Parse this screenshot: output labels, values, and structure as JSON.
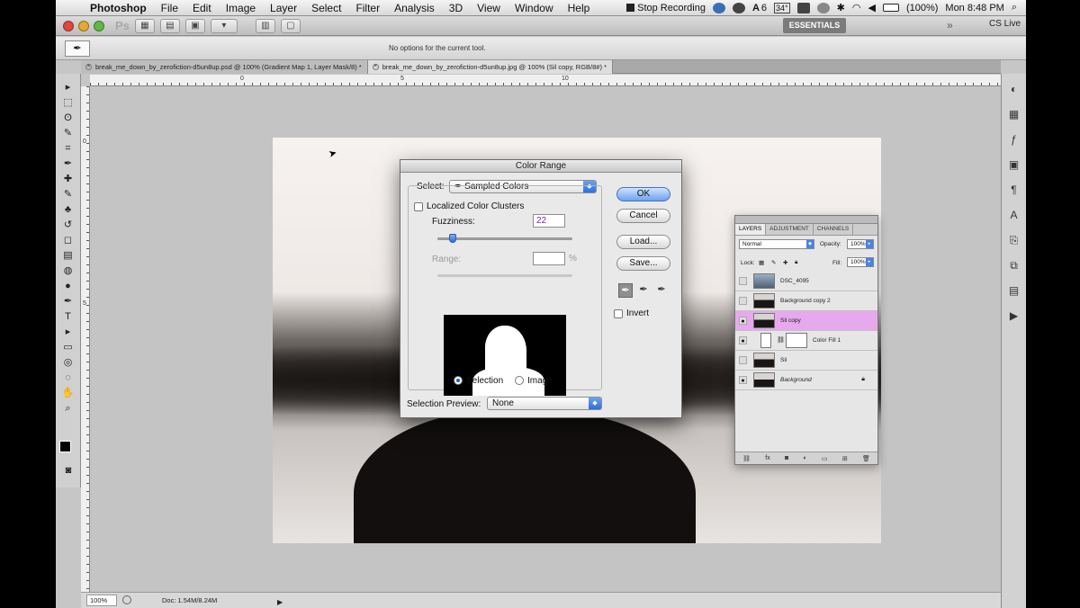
{
  "menubar": {
    "apple_symbol": "",
    "items": [
      "Photoshop",
      "File",
      "Edit",
      "Image",
      "Layer",
      "Select",
      "Filter",
      "Analysis",
      "3D",
      "View",
      "Window",
      "Help"
    ],
    "recording_label": "Stop Recording",
    "ai_label": "6",
    "temp_label": "34°",
    "battery": "(100%)",
    "clock": "Mon 8:48 PM"
  },
  "appbar": {
    "logo": "Ps",
    "essentials": "ESSENTIALS",
    "overflow": "»",
    "cslive": "CS Live"
  },
  "options_bar": {
    "message": "No options for the current tool."
  },
  "tabs": [
    {
      "label": "break_me_down_by_zerofiction-d5un8up.psd @ 100% (Gradient Map 1, Layer Mask/8) *",
      "active": false
    },
    {
      "label": "break_me_down_by_zerofiction-d5un8up.jpg @ 100% (Sil copy, RGB/8#) *",
      "active": true
    }
  ],
  "toolbox": {
    "tools": [
      "move-tool-icon",
      "marquee-tool-icon",
      "lasso-tool-icon",
      "quick-select-icon",
      "crop-tool-icon",
      "eyedropper-icon",
      "healing-brush-icon",
      "brush-icon",
      "clone-stamp-icon",
      "history-brush-icon",
      "eraser-icon",
      "gradient-icon",
      "blur-icon",
      "dodge-icon",
      "pen-icon",
      "type-icon",
      "path-select-icon",
      "shape-icon",
      "3d-rotate-icon",
      "3d-orbit-icon",
      "hand-icon",
      "zoom-icon"
    ],
    "glyphs": [
      "▸",
      "⬚",
      "ʘ",
      "✎",
      "⌗",
      "✒",
      "✚",
      "✎",
      "♣",
      "↺",
      "◻",
      "▤",
      "◍",
      "●",
      "✒",
      "T",
      "▸",
      "▭",
      "◎",
      "◌",
      "✋",
      "⌕"
    ]
  },
  "rulers": {
    "top": [
      "0",
      "5",
      "10"
    ],
    "left": [
      "0",
      "5"
    ]
  },
  "status": {
    "zoom": "100%",
    "doc_size": "Doc: 1.54M/8.24M",
    "arrow": "▶"
  },
  "dialog": {
    "title": "Color Range",
    "select_label": "Select:",
    "select_value": "Sampled Colors",
    "localized_label": "Localized Color Clusters",
    "localized_checked": false,
    "fuzziness_label": "Fuzziness:",
    "fuzziness_value": "22",
    "fuzziness_fraction": 0.11,
    "range_label": "Range:",
    "range_value": "",
    "range_unit": "%",
    "selection_label": "Selection",
    "image_label": "Image",
    "preview_mode": "selection",
    "selection_preview_label": "Selection Preview:",
    "selection_preview_value": "None",
    "buttons": {
      "ok": "OK",
      "cancel": "Cancel",
      "load": "Load...",
      "save": "Save..."
    },
    "invert_label": "Invert",
    "invert_checked": false,
    "eyedroppers": [
      "eyedropper-icon",
      "eyedropper-plus-icon",
      "eyedropper-minus-icon"
    ]
  },
  "layers_panel": {
    "tabs": [
      "LAYERS",
      "ADJUSTMENT",
      "CHANNELS"
    ],
    "blend_mode": "Normal",
    "opacity_label": "Opacity:",
    "opacity_value": "100%",
    "lock_label": "Lock:",
    "fill_label": "Fill:",
    "fill_value": "100%",
    "layers": [
      {
        "name": "DSC_4095",
        "visible": false,
        "selected": false,
        "type": "image",
        "italic": false
      },
      {
        "name": "Background copy 2",
        "visible": false,
        "selected": false,
        "type": "image",
        "italic": false
      },
      {
        "name": "Sil copy",
        "visible": true,
        "selected": true,
        "type": "image",
        "italic": false
      },
      {
        "name": "Color Fill 1",
        "visible": true,
        "selected": false,
        "type": "fill",
        "italic": false
      },
      {
        "name": "Sil",
        "visible": false,
        "selected": false,
        "type": "image",
        "italic": false
      },
      {
        "name": "Background",
        "visible": true,
        "selected": false,
        "type": "image",
        "italic": true,
        "locked": true
      }
    ],
    "footer_icons": [
      "link-layers-icon",
      "fx-icon",
      "add-mask-icon",
      "adjustment-layer-icon",
      "group-folder-icon",
      "new-layer-icon",
      "trash-icon"
    ]
  },
  "colors": {
    "selected_layer": "#e6a9ee",
    "accent_blue": "#2c6fe0"
  }
}
